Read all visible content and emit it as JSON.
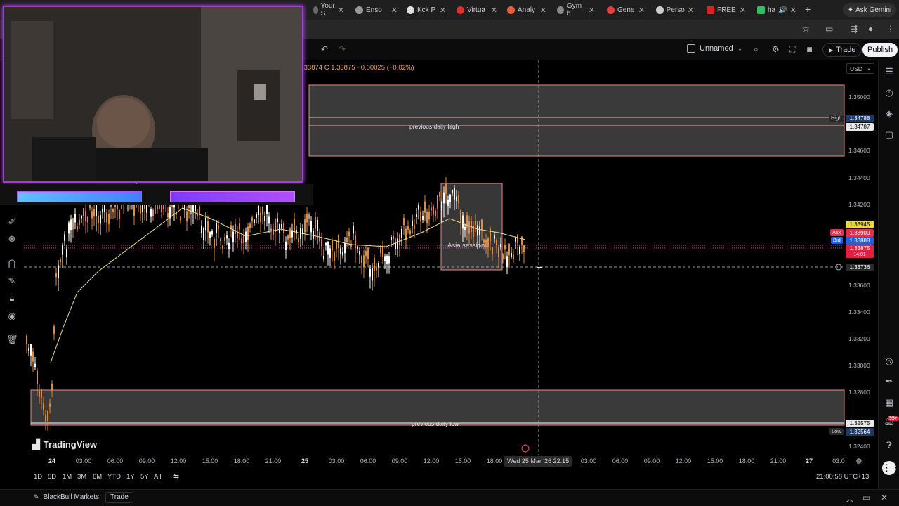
{
  "browser": {
    "tabs": [
      {
        "label": "Your S",
        "color": "#6a6a6a"
      },
      {
        "label": "Enso",
        "color": "#9a9a9a"
      },
      {
        "label": "Kck P",
        "color": "#dddddd"
      },
      {
        "label": "Virtua",
        "color": "#e03030"
      },
      {
        "label": "Analy",
        "color": "#e06040"
      },
      {
        "label": "Gym b",
        "color": "#888888"
      },
      {
        "label": "Gene",
        "color": "#e04040"
      },
      {
        "label": "Perso",
        "color": "#cccccc"
      },
      {
        "label": "FREE",
        "color": "#e02020"
      },
      {
        "label": "ha",
        "color": "#30c060"
      }
    ],
    "new_tab_icon": "+",
    "gemini_label": "Ask Gemini"
  },
  "toolbar": {
    "layout_name": "Unnamed",
    "trade_label": "Trade",
    "publish_label": "Publish",
    "undo_icon": "undo-icon",
    "redo_icon": "redo-icon"
  },
  "chart": {
    "ohlc_text": ".33874  C 1.33875  −0.00025 (−0.02%)",
    "currency": "USD",
    "price_labels": [
      "1.35000",
      "1.34600",
      "1.34400",
      "1.34200",
      "1.33600",
      "1.33400",
      "1.33200",
      "1.33000",
      "1.32800",
      "1.32400"
    ],
    "high_tag": "High",
    "high_value": "1.34788",
    "high_value2": "1.34787",
    "yellow_value": "1.33945",
    "ask_tag": "Ask",
    "ask_value": "1.33900",
    "bid_tag": "Bid",
    "bid_value": "1.33888",
    "red_value": "1.33875",
    "red_sub": "14:01",
    "crosshair_price": "1.33736",
    "low_tag": "Low",
    "low_value": "1.32564",
    "low_value2": "1.32575",
    "previous_daily_high": "previous daily high",
    "previous_daily_low": "previous daily low",
    "session_label": "Asia session",
    "crosshair_time": "Wed 25 Mar '26   22:15",
    "time_labels": [
      {
        "text": "24",
        "bold": true
      },
      {
        "text": "03:00"
      },
      {
        "text": "06:00"
      },
      {
        "text": "09:00"
      },
      {
        "text": "12:00"
      },
      {
        "text": "15:00"
      },
      {
        "text": "18:00"
      },
      {
        "text": "21:00"
      },
      {
        "text": "25",
        "bold": true
      },
      {
        "text": "03:00"
      },
      {
        "text": "06:00"
      },
      {
        "text": "09:00"
      },
      {
        "text": "12:00"
      },
      {
        "text": "15:00"
      },
      {
        "text": "18:00"
      },
      {
        "text": "03:00"
      },
      {
        "text": "06:00"
      },
      {
        "text": "09:00"
      },
      {
        "text": "12:00"
      },
      {
        "text": "15:00"
      },
      {
        "text": "18:00"
      },
      {
        "text": "21:00"
      },
      {
        "text": "27",
        "bold": true
      },
      {
        "text": "03:0"
      }
    ],
    "brand": "TradingView"
  },
  "ranges": [
    "1D",
    "5D",
    "1M",
    "3M",
    "6M",
    "YTD",
    "1Y",
    "5Y",
    "All"
  ],
  "clock": "21:00:58 UTC+13",
  "broker": {
    "name": "BlackBull Markets",
    "trade_label": "Trade"
  },
  "notification_count": "99+",
  "colors": {
    "zone_fill": "#3a3a3a",
    "zone_border": "#f08a8a",
    "candle_up": "#ffffff",
    "candle_down": "#e08a3a",
    "ma_line": "#e8e090"
  }
}
